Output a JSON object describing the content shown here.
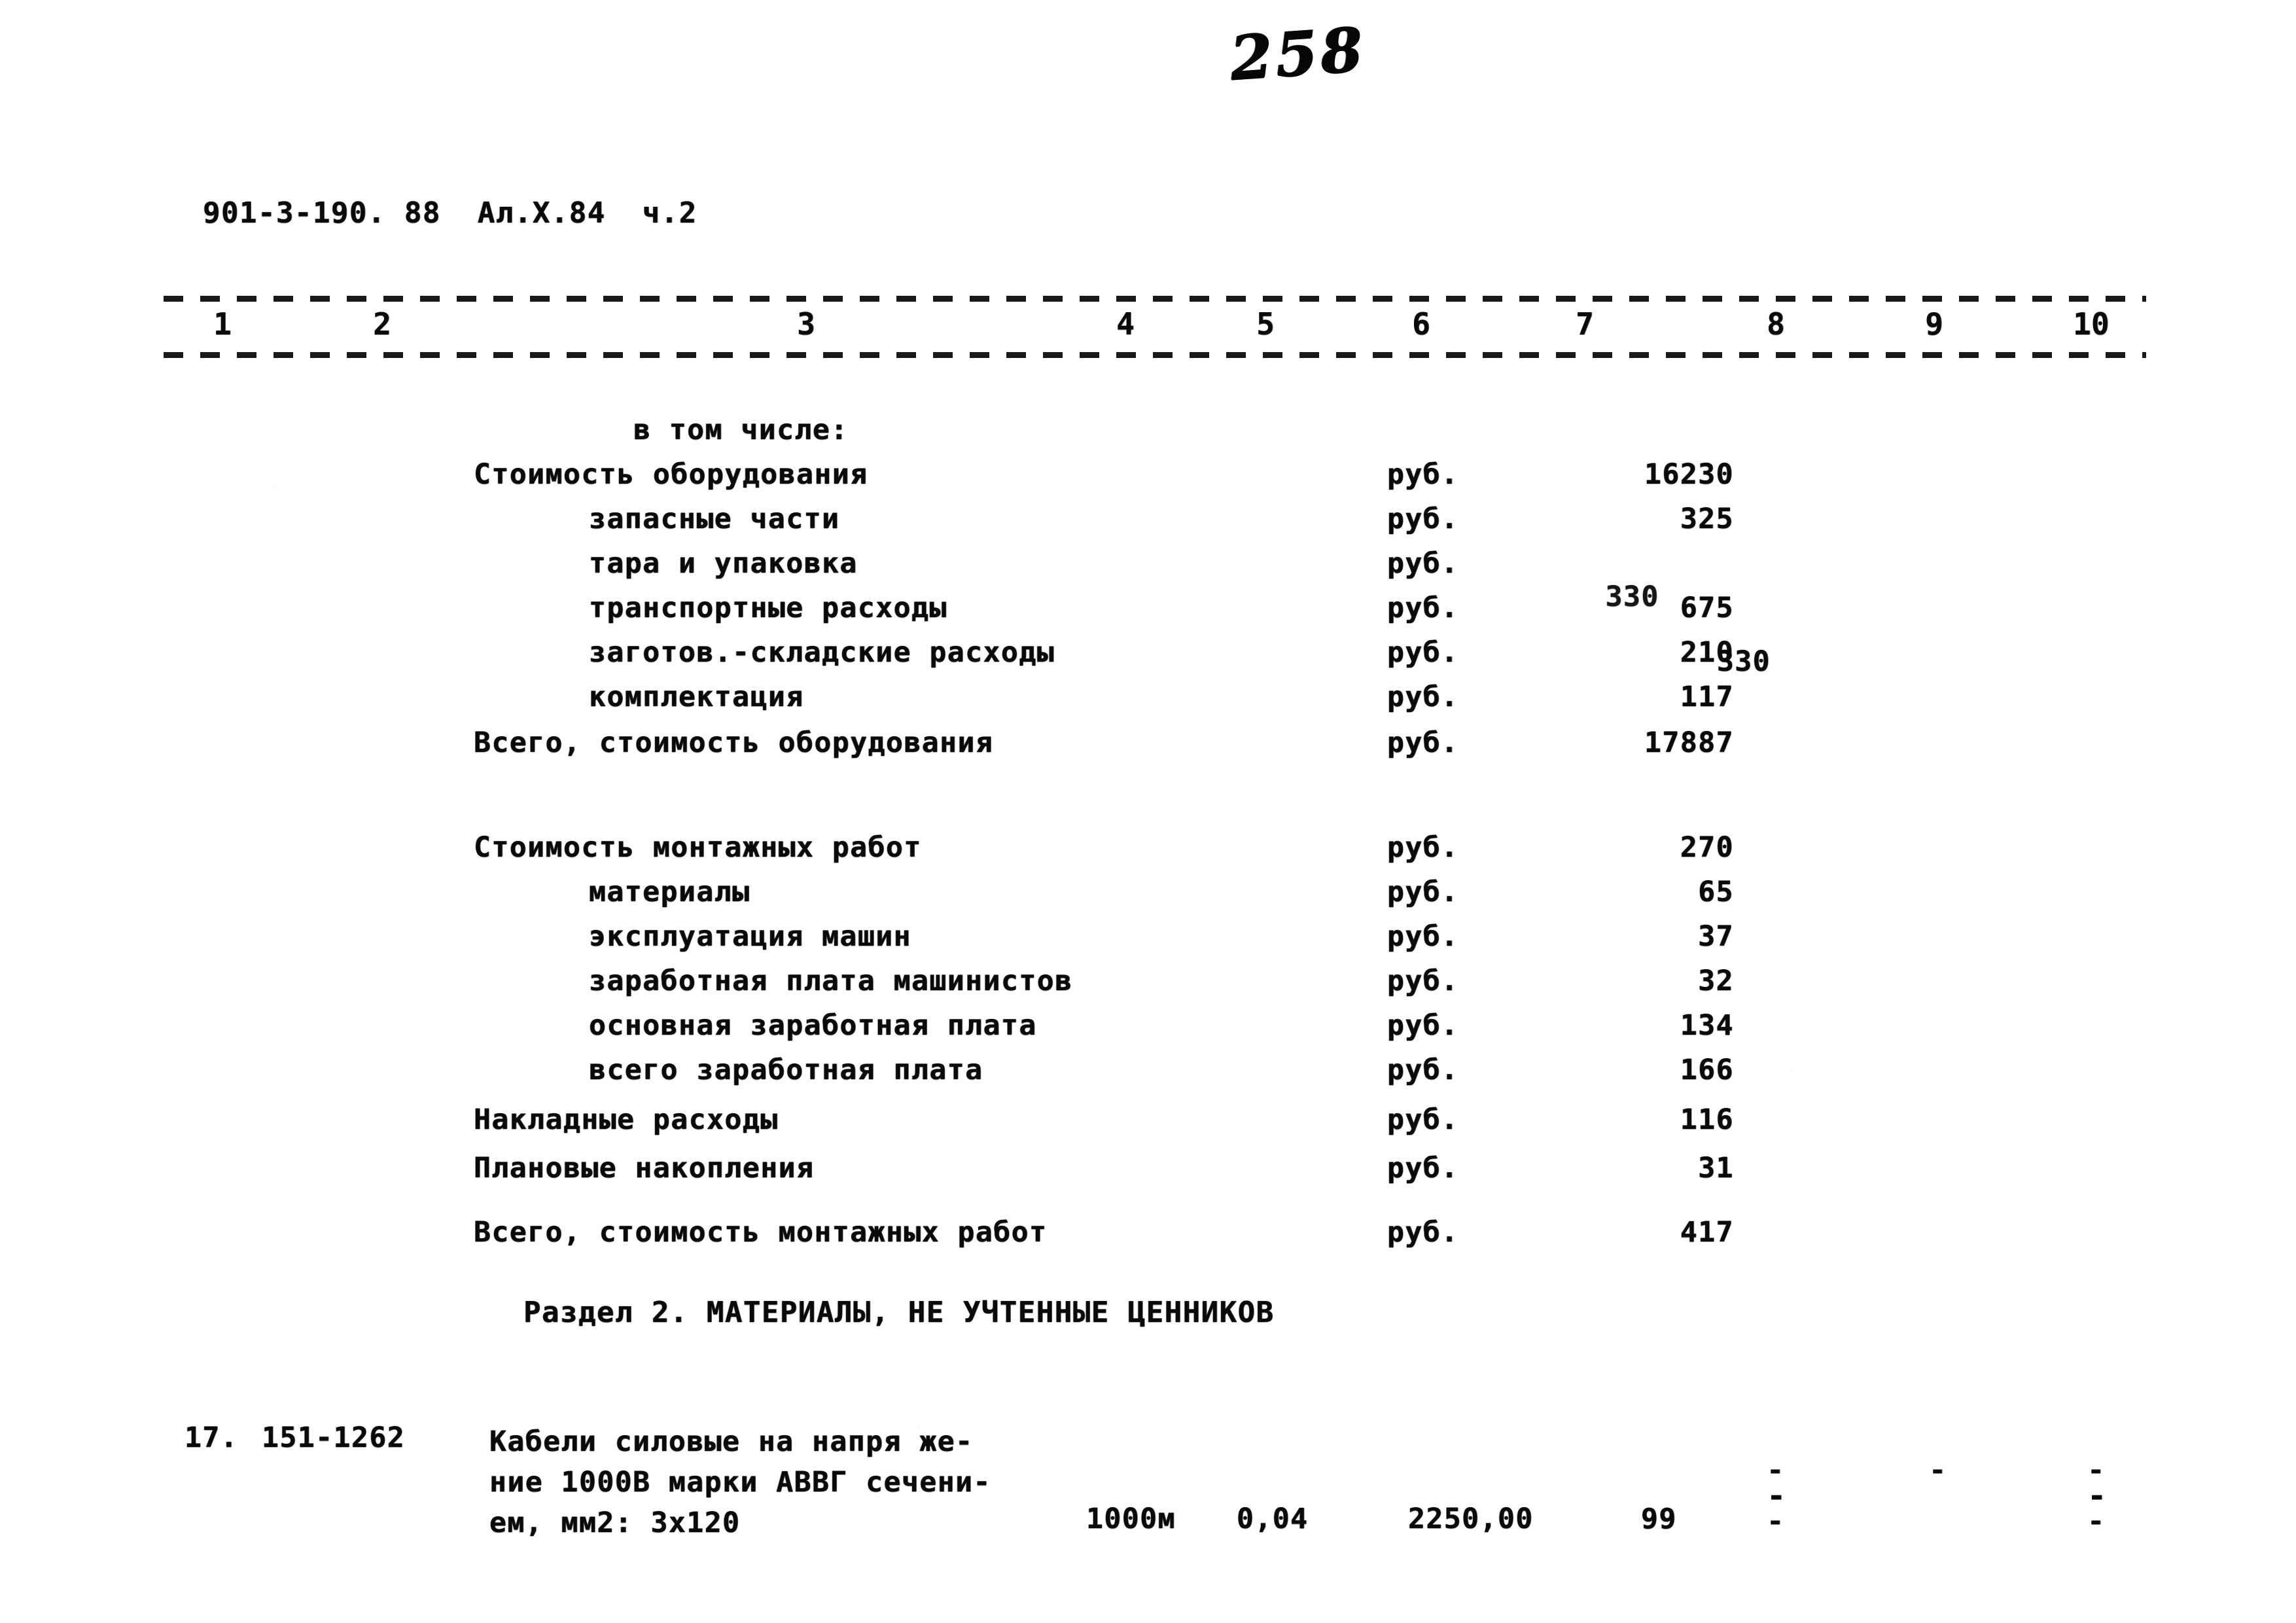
{
  "page": {
    "handwritten_page_number": "258",
    "document_header": "901-3-190. 88  Ал.Х.84  ч.2"
  },
  "column_numbers": [
    "1",
    "2",
    "3",
    "4",
    "5",
    "6",
    "7",
    "8",
    "9",
    "10"
  ],
  "equipment_section": {
    "intro_label": "в том числе:",
    "rows": [
      {
        "label": "Стоимость оборудования",
        "unit": "руб.",
        "amount": "16230",
        "indent": 0
      },
      {
        "label": "запасные части",
        "unit": "руб.",
        "amount": "325",
        "indent": 1
      },
      {
        "label": "тара и упаковка",
        "unit": "руб.",
        "amount": "330",
        "indent": 1,
        "overstruck": true
      },
      {
        "label": "транспортные расходы",
        "unit": "руб.",
        "amount": "675",
        "indent": 1
      },
      {
        "label": "заготов.-складские расходы",
        "unit": "руб.",
        "amount": "210",
        "indent": 1
      },
      {
        "label": "комплектация",
        "unit": "руб.",
        "amount": "117",
        "indent": 1
      }
    ],
    "total": {
      "label": "Всего, стоимость оборудования",
      "unit": "руб.",
      "amount": "17887"
    }
  },
  "installation_section": {
    "rows": [
      {
        "label": "Стоимость монтажных работ",
        "unit": "руб.",
        "amount": "270",
        "indent": 0
      },
      {
        "label": "материалы",
        "unit": "руб.",
        "amount": "65",
        "indent": 1
      },
      {
        "label": "эксплуатация машин",
        "unit": "руб.",
        "amount": "37",
        "indent": 1
      },
      {
        "label": "заработная плата машинистов",
        "unit": "руб.",
        "amount": "32",
        "indent": 1
      },
      {
        "label": "основная заработная плата",
        "unit": "руб.",
        "amount": "134",
        "indent": 1
      },
      {
        "label": "всего заработная плата",
        "unit": "руб.",
        "amount": "166",
        "indent": 1
      },
      {
        "label": "Накладные расходы",
        "unit": "руб.",
        "amount": "116",
        "indent": 0
      },
      {
        "label": "Плановые накопления",
        "unit": "руб.",
        "amount": "31",
        "indent": 0
      }
    ],
    "total": {
      "label": "Всего, стоимость монтажных работ",
      "unit": "руб.",
      "amount": "417"
    }
  },
  "section_heading": "Раздел 2. МАТЕРИАЛЫ, НЕ УЧТЕННЫЕ ЦЕННИКОВ",
  "material_row": {
    "number": "17.",
    "code": "151-1262",
    "description_lines": [
      "Кабели силовые на напря же-",
      "ние 1000В марки АВВГ сечени-",
      "ем, мм2: 3х120"
    ],
    "unit": "1000м",
    "quantity": "0,04",
    "price": "2250,00",
    "total": "99",
    "empty_marks": [
      "-",
      "-",
      "-"
    ],
    "extra_marks": [
      "-",
      "-",
      "-"
    ]
  }
}
